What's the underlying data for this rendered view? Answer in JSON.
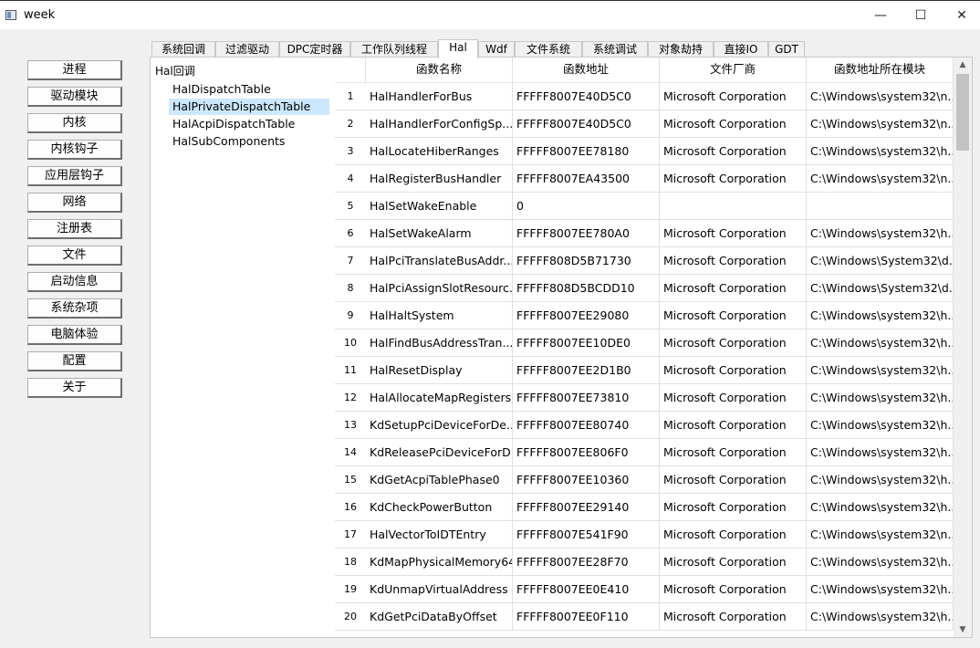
{
  "window": {
    "title": "week",
    "minimize": "—",
    "maximize": "☐",
    "close": "✕"
  },
  "nav": [
    "进程",
    "驱动模块",
    "内核",
    "内核钩子",
    "应用层钩子",
    "网络",
    "注册表",
    "文件",
    "启动信息",
    "系统杂项",
    "电脑体验",
    "配置",
    "关于"
  ],
  "tabs": [
    "系统回调",
    "过滤驱动",
    "DPC定时器",
    "工作队列线程",
    "Hal",
    "Wdf",
    "文件系统",
    "系统调试",
    "对象劫持",
    "直接IO",
    "GDT"
  ],
  "active_tab": "Hal",
  "tree": {
    "root": "Hal回调",
    "items": [
      "HalDispatchTable",
      "HalPrivateDispatchTable",
      "HalAcpiDispatchTable",
      "HalSubComponents"
    ],
    "selected": "HalPrivateDispatchTable"
  },
  "table": {
    "columns": [
      "函数名称",
      "函数地址",
      "文件厂商",
      "函数地址所在模块"
    ],
    "rows": [
      [
        "1",
        "HalHandlerForBus",
        "FFFFF8007E40D5C0",
        "Microsoft Corporation",
        "C:\\Windows\\system32\\n..."
      ],
      [
        "2",
        "HalHandlerForConfigSp...",
        "FFFFF8007E40D5C0",
        "Microsoft Corporation",
        "C:\\Windows\\system32\\n..."
      ],
      [
        "3",
        "HalLocateHiberRanges",
        "FFFFF8007EE78180",
        "Microsoft Corporation",
        "C:\\Windows\\system32\\h..."
      ],
      [
        "4",
        "HalRegisterBusHandler",
        "FFFFF8007EA43500",
        "Microsoft Corporation",
        "C:\\Windows\\system32\\n..."
      ],
      [
        "5",
        "HalSetWakeEnable",
        "0",
        "",
        ""
      ],
      [
        "6",
        "HalSetWakeAlarm",
        "FFFFF8007EE780A0",
        "Microsoft Corporation",
        "C:\\Windows\\system32\\h..."
      ],
      [
        "7",
        "HalPciTranslateBusAddr...",
        "FFFFF808D5B71730",
        "Microsoft Corporation",
        "C:\\Windows\\System32\\d..."
      ],
      [
        "8",
        "HalPciAssignSlotResourc...",
        "FFFFF808D5BCDD10",
        "Microsoft Corporation",
        "C:\\Windows\\System32\\d..."
      ],
      [
        "9",
        "HalHaltSystem",
        "FFFFF8007EE29080",
        "Microsoft Corporation",
        "C:\\Windows\\system32\\h..."
      ],
      [
        "10",
        "HalFindBusAddressTran...",
        "FFFFF8007EE10DE0",
        "Microsoft Corporation",
        "C:\\Windows\\system32\\h..."
      ],
      [
        "11",
        "HalResetDisplay",
        "FFFFF8007EE2D1B0",
        "Microsoft Corporation",
        "C:\\Windows\\system32\\h..."
      ],
      [
        "12",
        "HalAllocateMapRegisters",
        "FFFFF8007EE73810",
        "Microsoft Corporation",
        "C:\\Windows\\system32\\h..."
      ],
      [
        "13",
        "KdSetupPciDeviceForDe...",
        "FFFFF8007EE80740",
        "Microsoft Corporation",
        "C:\\Windows\\system32\\h..."
      ],
      [
        "14",
        "KdReleasePciDeviceForD...",
        "FFFFF8007EE806F0",
        "Microsoft Corporation",
        "C:\\Windows\\system32\\h..."
      ],
      [
        "15",
        "KdGetAcpiTablePhase0",
        "FFFFF8007EE10360",
        "Microsoft Corporation",
        "C:\\Windows\\system32\\h..."
      ],
      [
        "16",
        "KdCheckPowerButton",
        "FFFFF8007EE29140",
        "Microsoft Corporation",
        "C:\\Windows\\system32\\h..."
      ],
      [
        "17",
        "HalVectorToIDTEntry",
        "FFFFF8007E541F90",
        "Microsoft Corporation",
        "C:\\Windows\\system32\\n..."
      ],
      [
        "18",
        "KdMapPhysicalMemory64",
        "FFFFF8007EE28F70",
        "Microsoft Corporation",
        "C:\\Windows\\system32\\h..."
      ],
      [
        "19",
        "KdUnmapVirtualAddress",
        "FFFFF8007EE0E410",
        "Microsoft Corporation",
        "C:\\Windows\\system32\\h..."
      ],
      [
        "20",
        "KdGetPciDataByOffset",
        "FFFFF8007EE0F110",
        "Microsoft Corporation",
        "C:\\Windows\\system32\\h..."
      ]
    ]
  }
}
